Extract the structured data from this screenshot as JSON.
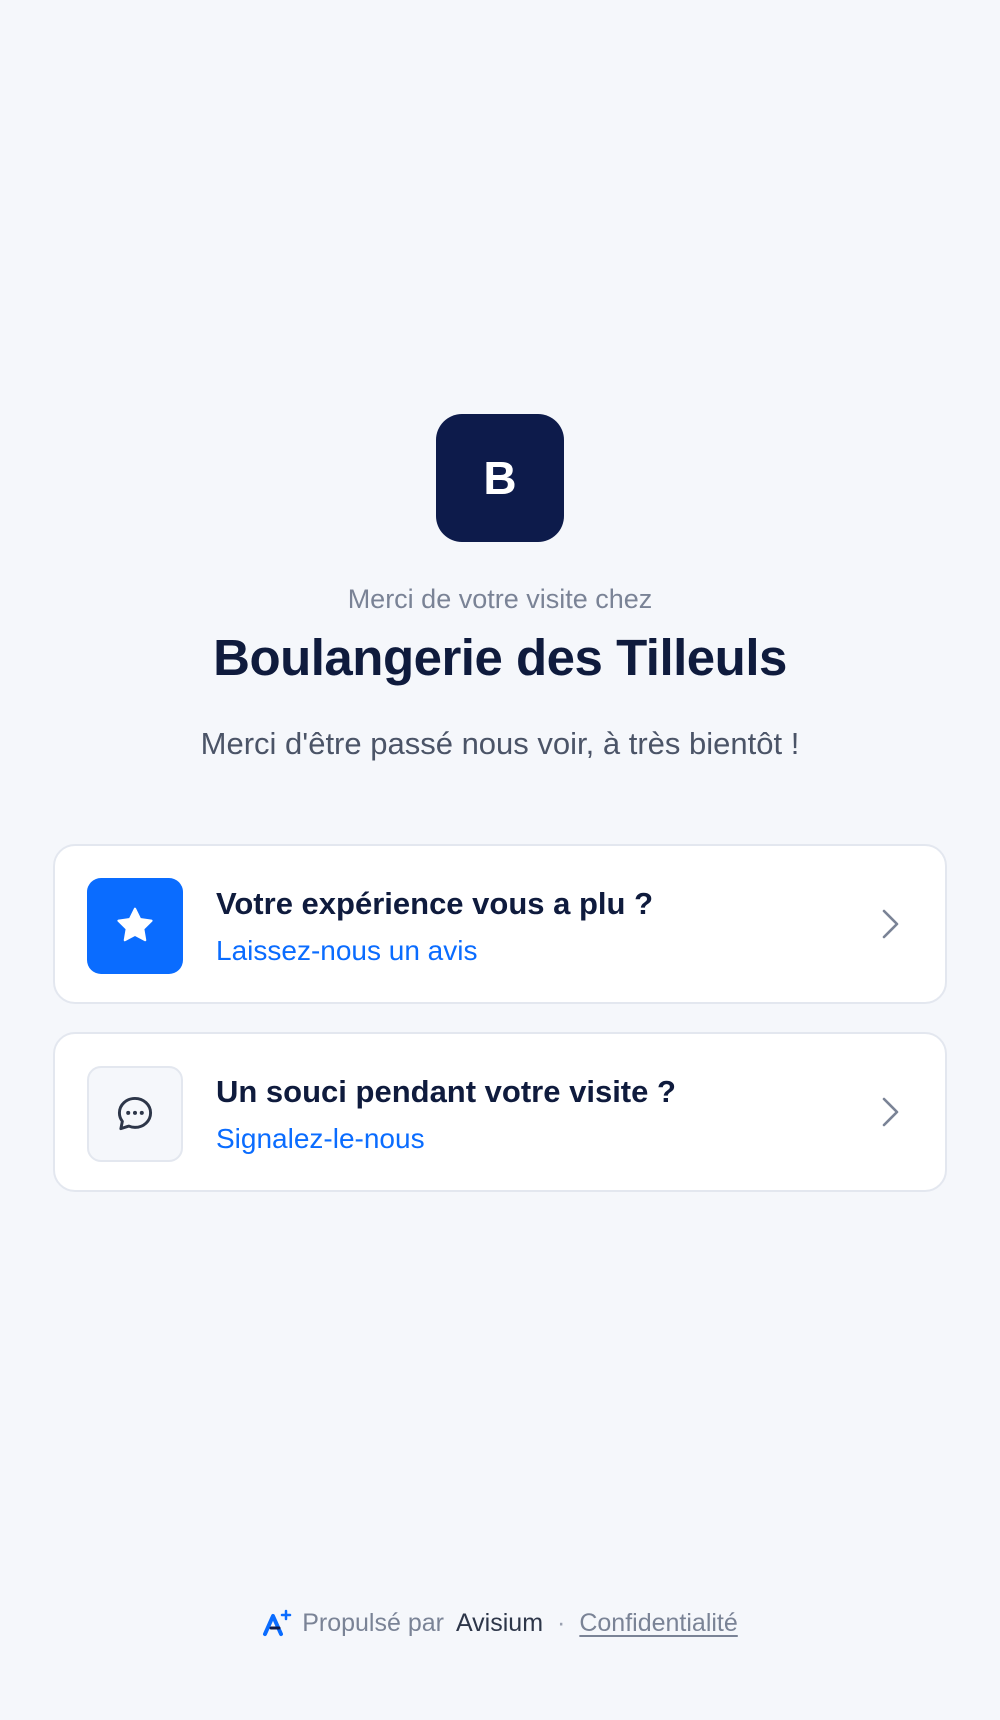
{
  "business": {
    "logo_letter": "B",
    "eyebrow": "Merci de votre visite chez",
    "name": "Boulangerie des Tilleuls",
    "message": "Merci d'être passé nous voir, à très bientôt !"
  },
  "cards": [
    {
      "icon": "star-icon",
      "title": "Votre expérience vous a plu ?",
      "link": "Laissez-nous un avis"
    },
    {
      "icon": "chat-bubble-icon",
      "title": "Un souci pendant votre visite ?",
      "link": "Signalez-le-nous"
    }
  ],
  "footer": {
    "powered_by": "Propulsé par",
    "brand": "Avisium",
    "separator": "·",
    "privacy": "Confidentialité"
  },
  "colors": {
    "background": "#f5f7fb",
    "logo_background": "#0d1b4b",
    "accent": "#0a6cff",
    "text_primary": "#0f1b3d",
    "text_muted": "#7a8396"
  }
}
